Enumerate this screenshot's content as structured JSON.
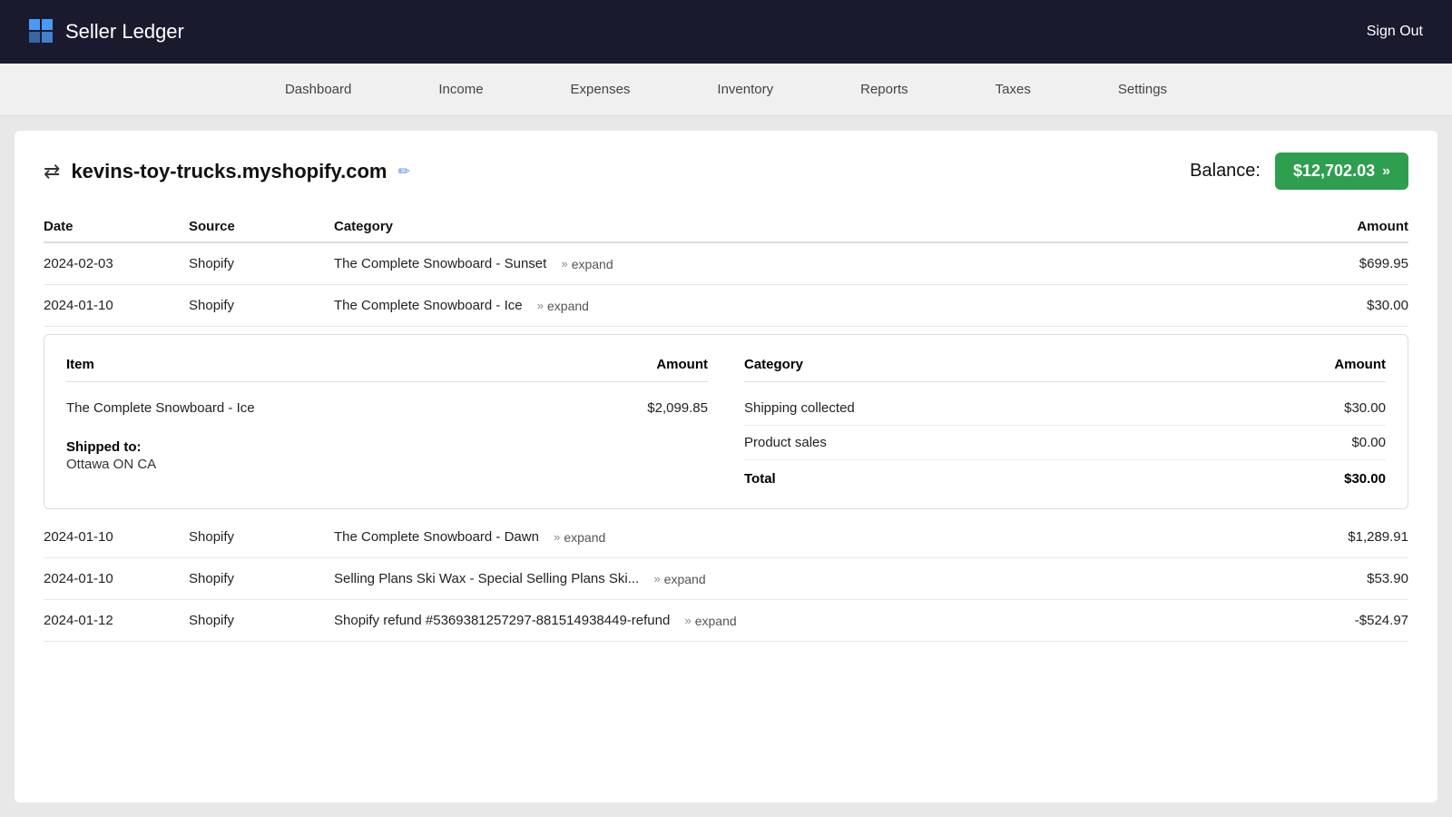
{
  "header": {
    "logo_text": "Seller Ledger",
    "sign_out_label": "Sign Out"
  },
  "nav": {
    "items": [
      {
        "label": "Dashboard",
        "id": "dashboard"
      },
      {
        "label": "Income",
        "id": "income"
      },
      {
        "label": "Expenses",
        "id": "expenses"
      },
      {
        "label": "Inventory",
        "id": "inventory"
      },
      {
        "label": "Reports",
        "id": "reports"
      },
      {
        "label": "Taxes",
        "id": "taxes"
      },
      {
        "label": "Settings",
        "id": "settings"
      }
    ]
  },
  "account": {
    "name": "kevins-toy-trucks.myshopify.com",
    "balance_label": "Balance:",
    "balance_amount": "$12,702.03"
  },
  "table": {
    "headers": {
      "date": "Date",
      "source": "Source",
      "category": "Category",
      "amount": "Amount"
    },
    "rows": [
      {
        "date": "2024-02-03",
        "source": "Shopify",
        "category": "The Complete Snowboard - Sunset",
        "expand_label": "expand",
        "amount": "$699.95",
        "expanded": false
      },
      {
        "date": "2024-01-10",
        "source": "Shopify",
        "category": "The Complete Snowboard - Ice",
        "expand_label": "expand",
        "amount": "$30.00",
        "expanded": true,
        "detail": {
          "left_headers": {
            "item": "Item",
            "amount": "Amount"
          },
          "left_rows": [
            {
              "item": "The Complete Snowboard - Ice",
              "amount": "$2,099.85"
            }
          ],
          "shipped_label": "Shipped to:",
          "shipped_value": "Ottawa ON CA",
          "right_headers": {
            "category": "Category",
            "amount": "Amount"
          },
          "right_rows": [
            {
              "category": "Shipping collected",
              "amount": "$30.00"
            },
            {
              "category": "Product sales",
              "amount": "$0.00"
            }
          ],
          "total_label": "Total",
          "total_amount": "$30.00"
        }
      },
      {
        "date": "2024-01-10",
        "source": "Shopify",
        "category": "The Complete Snowboard - Dawn",
        "expand_label": "expand",
        "amount": "$1,289.91",
        "expanded": false
      },
      {
        "date": "2024-01-10",
        "source": "Shopify",
        "category": "Selling Plans Ski Wax - Special Selling Plans Ski...",
        "expand_label": "expand",
        "amount": "$53.90",
        "expanded": false
      },
      {
        "date": "2024-01-12",
        "source": "Shopify",
        "category": "Shopify refund #5369381257297-881514938449-refund",
        "expand_label": "expand",
        "amount": "-$524.97",
        "expanded": false
      }
    ]
  }
}
